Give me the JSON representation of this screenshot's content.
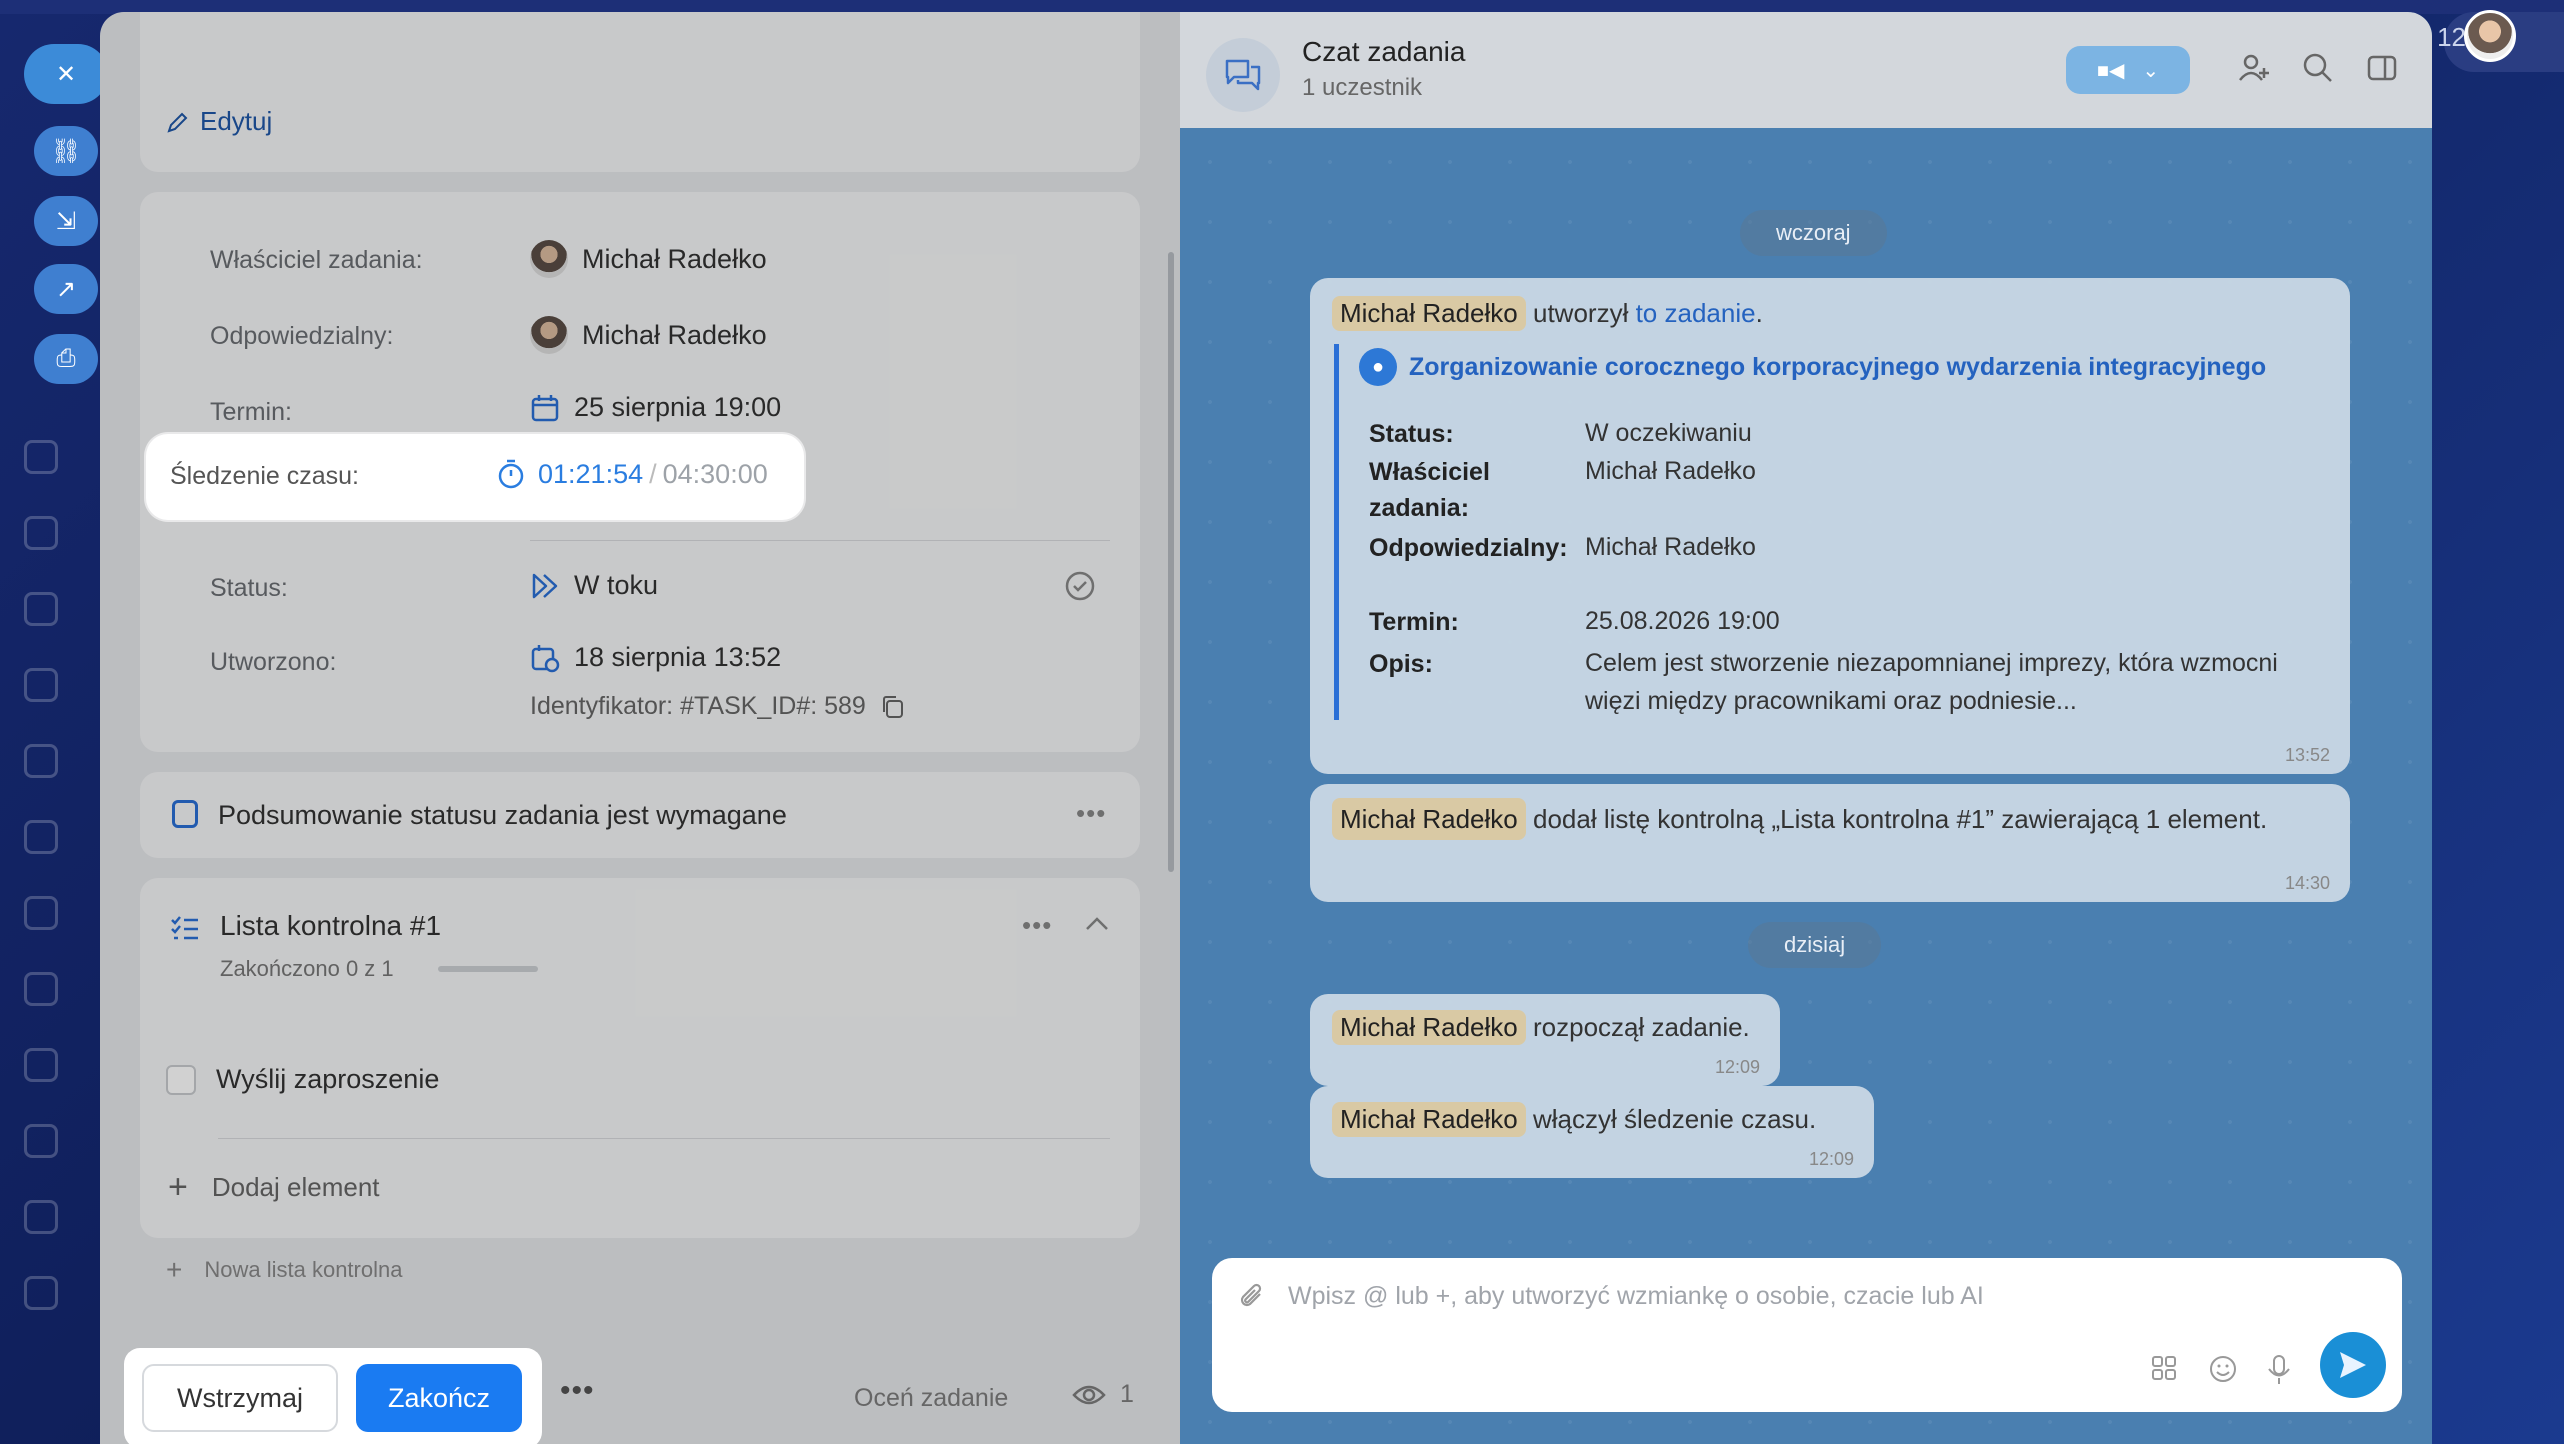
{
  "background": {
    "counter": "12"
  },
  "task": {
    "edit_label": "Edytuj",
    "details": {
      "owner_label": "Właściciel zadania:",
      "owner_value": "Michał Radełko",
      "responsible_label": "Odpowiedzialny:",
      "responsible_value": "Michał Radełko",
      "deadline_label": "Termin:",
      "deadline_value": "25 sierpnia 19:00",
      "tracking_label": "Śledzenie czasu:",
      "tracking_current": "01:21:54",
      "tracking_sep": "/",
      "tracking_total": "04:30:00",
      "status_label": "Status:",
      "status_value": "W toku",
      "created_label": "Utworzono:",
      "created_value": "18 sierpnia 13:52",
      "identifier": "Identyfikator: #TASK_ID#: 589"
    },
    "summary_text": "Podsumowanie statusu zadania jest wymagane",
    "checklist": {
      "title": "Lista kontrolna #1",
      "progress_text": "Zakończono 0 z 1",
      "progress_fraction": 0,
      "item_label": "Wyślij zaproszenie",
      "add_item_label": "Dodaj element"
    },
    "new_checklist_label": "Nowa lista kontrolna",
    "footer": {
      "pause_label": "Wstrzymaj",
      "finish_label": "Zakończ",
      "rate_label": "Oceń zadanie",
      "watchers_count": "1"
    }
  },
  "chat": {
    "title": "Czat zadania",
    "subtitle": "1 uczestnik",
    "date_yesterday": "wczoraj",
    "date_today": "dzisiaj",
    "messages": {
      "m1_name": "Michał Radełko",
      "m1_text": "utworzył",
      "m1_link": "to zadanie",
      "m1_end": ".",
      "m1_time": "13:52",
      "card_title": "Zorganizowanie corocznego korporacyjnego wydarzenia integracyjnego",
      "card_status_label": "Status:",
      "card_status_value": "W oczekiwaniu",
      "card_owner_label": "Właściciel zadania:",
      "card_owner_value": "Michał Radełko",
      "card_resp_label": "Odpowiedzialny:",
      "card_resp_value": "Michał Radełko",
      "card_deadline_label": "Termin:",
      "card_deadline_value": "25.08.2026 19:00",
      "card_desc_label": "Opis:",
      "card_desc_value": "Celem jest stworzenie niezapomnianej imprezy, która wzmocni więzi między pracownikami oraz podniesie...",
      "m2_name": "Michał Radełko",
      "m2_text": "dodał listę kontrolną „Lista kontrolna #1” zawierającą 1 element.",
      "m2_time": "14:30",
      "m3_name": "Michał Radełko",
      "m3_text": "rozpoczął zadanie.",
      "m3_time": "12:09",
      "m4_name": "Michał Radełko",
      "m4_text": "włączył śledzenie czasu.",
      "m4_time": "12:09"
    },
    "composer_placeholder": "Wpisz @ lub +, aby utworzyć wzmiankę o osobie, czacie lub AI"
  },
  "colors": {
    "accent": "#1a7bf2",
    "tracking": "#2a7de0",
    "chat_bg": "#4a7fb0"
  }
}
